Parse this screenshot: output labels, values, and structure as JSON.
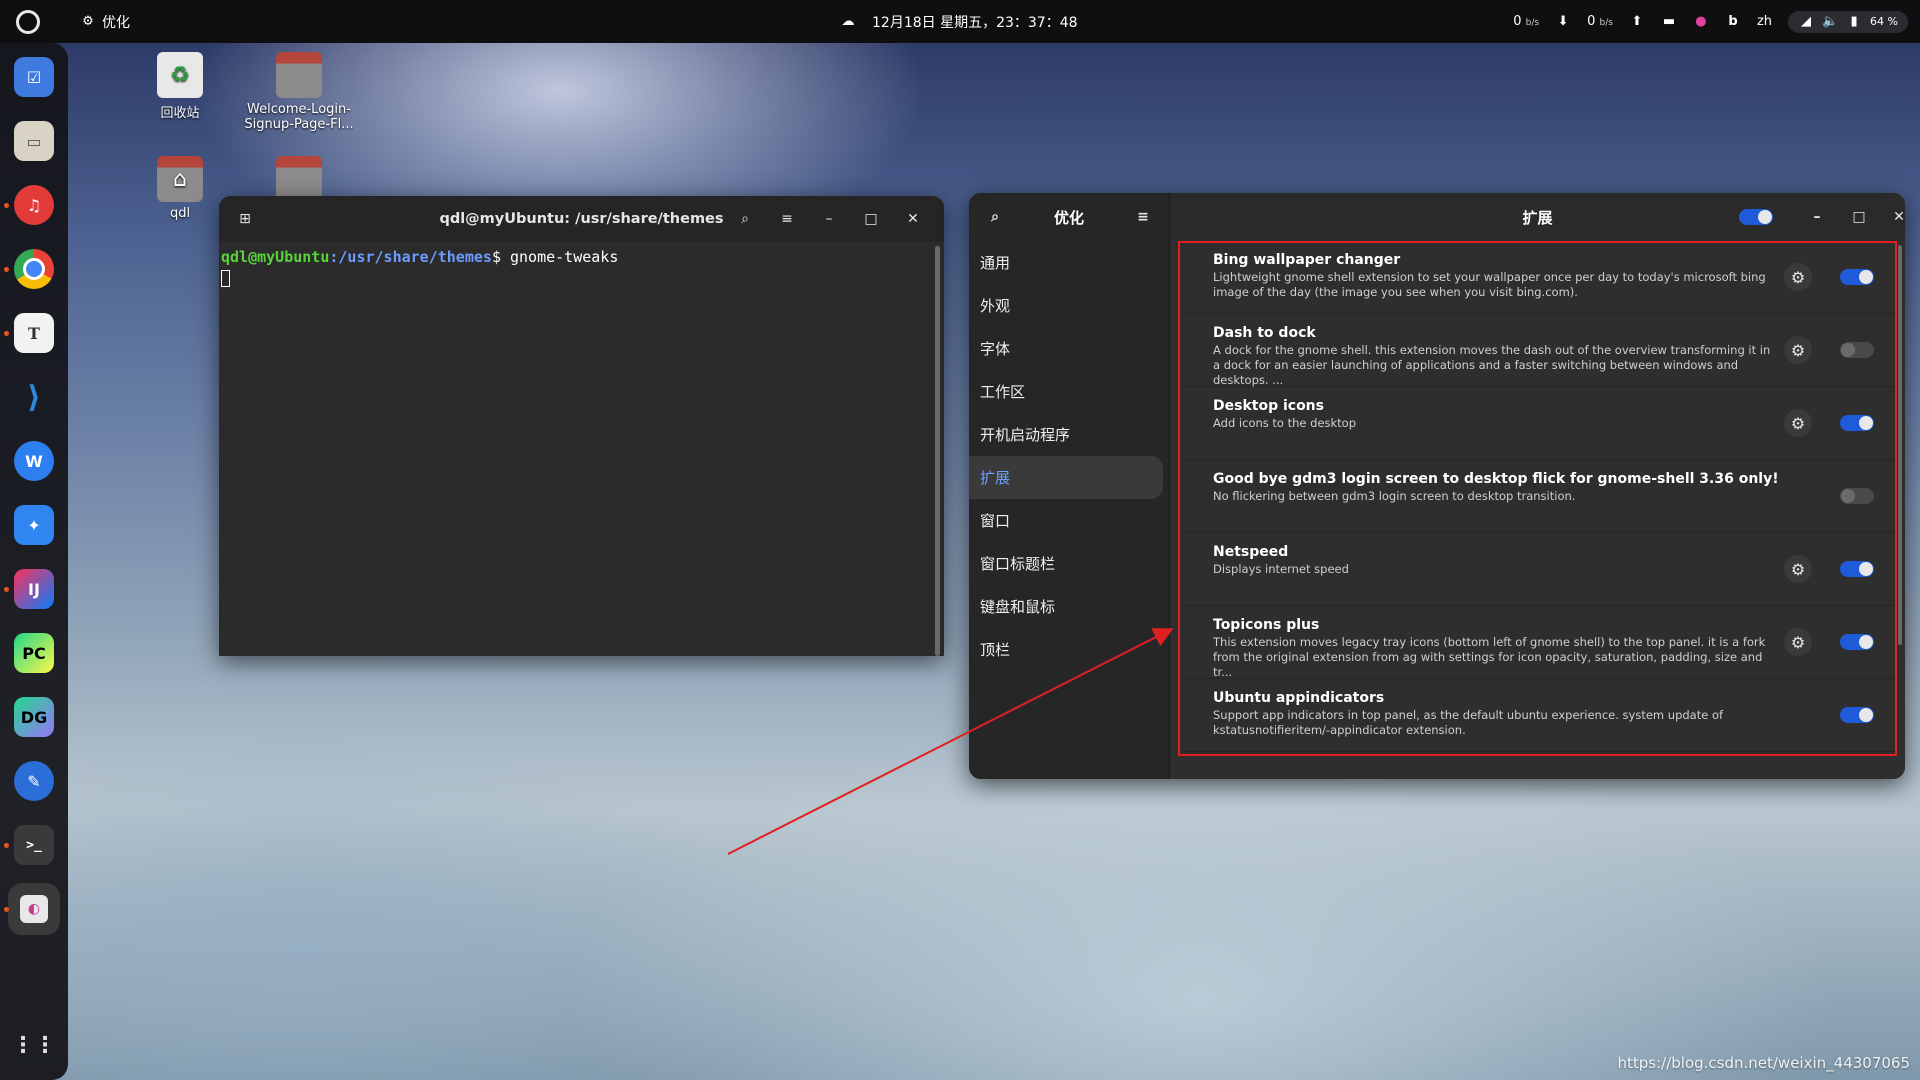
{
  "topbar": {
    "app_name": "优化",
    "datetime": "12月18日 星期五，23：37：48",
    "net_down": "0",
    "net_up": "0",
    "net_unit": "b/s",
    "lang": "zh",
    "battery": "64 %"
  },
  "desktop": {
    "icons": [
      {
        "label": "回收站"
      },
      {
        "label": "Welcome-Login-Signup-Page-Fl..."
      },
      {
        "label": "qdl"
      },
      {
        "label": ""
      }
    ]
  },
  "dock": {
    "apps": [
      "tasks",
      "files",
      "netease-music",
      "chrome",
      "typora",
      "vscode",
      "wps",
      "star",
      "intellij",
      "pycharm",
      "datagrip",
      "url-tool",
      "terminal",
      "tweaks"
    ],
    "labels": {
      "typora": "T",
      "intellij": "IJ",
      "pycharm": "PC",
      "datagrip": "DG",
      "terminal": ">_"
    }
  },
  "terminal": {
    "title": "qdl@myUbuntu: /usr/share/themes",
    "user": "qdl@myUbuntu",
    "path": ":/usr/share/themes",
    "prompt_sign": "$ ",
    "command": "gnome-tweaks"
  },
  "tweaks": {
    "sidebar_title": "优化",
    "main_title": "扩展",
    "nav": [
      "通用",
      "外观",
      "字体",
      "工作区",
      "开机启动程序",
      "扩展",
      "窗口",
      "窗口标题栏",
      "键盘和鼠标",
      "顶栏"
    ],
    "active_nav": "扩展",
    "extensions": [
      {
        "name": "Bing wallpaper changer",
        "desc": "Lightweight gnome shell extension to set your wallpaper once per day to today's microsoft bing image of the day (the image you see when you visit bing.com).",
        "has_settings": true,
        "enabled": true
      },
      {
        "name": "Dash to dock",
        "desc": "A dock for the gnome shell. this extension moves the dash out of the overview transforming it in a dock for an easier launching of applications and a faster switching between windows and desktops. ...",
        "has_settings": true,
        "enabled": false
      },
      {
        "name": "Desktop icons",
        "desc": "Add icons to the desktop",
        "has_settings": true,
        "enabled": true
      },
      {
        "name": "Good bye gdm3 login screen to desktop flick for gnome-shell 3.36 only!",
        "desc": "No flickering between gdm3 login screen to desktop transition.",
        "has_settings": false,
        "enabled": false
      },
      {
        "name": "Netspeed",
        "desc": "Displays internet speed",
        "has_settings": true,
        "enabled": true
      },
      {
        "name": "Topicons plus",
        "desc": "This extension moves legacy tray icons (bottom left of gnome shell) to the top panel. it is a fork from the original extension from ag  with settings for icon opacity, saturation, padding, size and tr...",
        "has_settings": true,
        "enabled": true
      },
      {
        "name": "Ubuntu appindicators",
        "desc": "Support app indicators in top panel, as the default ubuntu experience. system update of kstatusnotifieritem/-appindicator extension.",
        "has_settings": false,
        "enabled": true
      }
    ]
  },
  "watermark": "https://blog.csdn.net/weixin_44307065",
  "colors": {
    "accent": "#1f5bd8",
    "highlight_box": "#e02020",
    "arrow": "#e02020"
  }
}
